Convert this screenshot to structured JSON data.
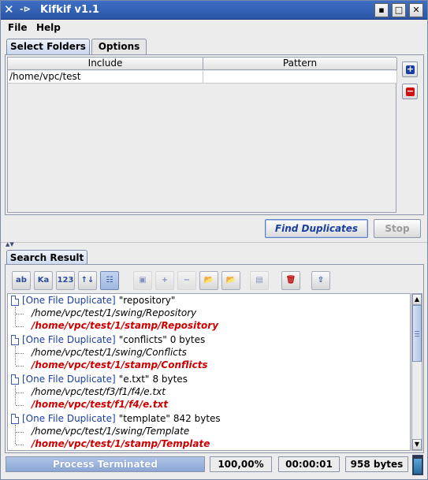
{
  "window": {
    "title": "Kifkif v1.1",
    "buttons": [
      "minimize",
      "maximize",
      "close"
    ],
    "accent_color": "#2a56a6"
  },
  "menu": [
    "File",
    "Help"
  ],
  "tabs": [
    {
      "label": "Select Folders",
      "active": true
    },
    {
      "label": "Options",
      "active": false
    }
  ],
  "folders_table": {
    "columns": [
      "Include",
      "Pattern"
    ],
    "rows": [
      {
        "include": "/home/vpc/test",
        "pattern": ""
      }
    ]
  },
  "side_buttons": [
    {
      "icon": "plus-icon",
      "color": "#1a3fa0"
    },
    {
      "icon": "minus-icon",
      "color": "#cc1111"
    }
  ],
  "actions": {
    "find": "Find Duplicates",
    "stop": "Stop"
  },
  "result_tab": "Search Result",
  "toolbar": [
    {
      "name": "sort-by-name",
      "text": "ab",
      "icon": "sort-alpha-icon",
      "state": "normal"
    },
    {
      "name": "sort-by-kind",
      "text": "Ka",
      "icon": "sort-kind-icon",
      "state": "normal"
    },
    {
      "name": "sort-by-number",
      "text": "123",
      "icon": "sort-number-icon",
      "state": "normal"
    },
    {
      "name": "sort-order",
      "text": "↑↓",
      "icon": "sort-order-icon",
      "state": "normal"
    },
    {
      "name": "tree-view",
      "text": "☷",
      "icon": "tree-view-icon",
      "state": "active"
    },
    {
      "name": "select-all",
      "text": "▣",
      "icon": "select-all-icon",
      "state": "disabled"
    },
    {
      "name": "expand",
      "text": "+",
      "icon": "expand-icon",
      "state": "disabled"
    },
    {
      "name": "collapse",
      "text": "−",
      "icon": "collapse-icon",
      "state": "disabled"
    },
    {
      "name": "open-folder",
      "text": "📂",
      "icon": "open-folder-icon",
      "state": "normal"
    },
    {
      "name": "open-folder-red",
      "text": "📂",
      "icon": "open-folder-red-icon",
      "state": "normal"
    },
    {
      "name": "properties",
      "text": "▤",
      "icon": "properties-icon",
      "state": "disabled"
    },
    {
      "name": "delete",
      "text": "🗑",
      "icon": "trash-icon",
      "state": "normal"
    },
    {
      "name": "export",
      "text": "⇧",
      "icon": "export-icon",
      "state": "normal"
    }
  ],
  "results": [
    {
      "type": "[One File Duplicate]",
      "name": "\"repository\"",
      "size": "",
      "paths": [
        {
          "text": "/home/vpc/test/1/swing/Repository",
          "keep": false
        },
        {
          "text": "/home/vpc/test/1/stamp/Repository",
          "keep": true
        }
      ]
    },
    {
      "type": "[One File Duplicate]",
      "name": "\"conflicts\"",
      "size": "0 bytes",
      "paths": [
        {
          "text": "/home/vpc/test/1/swing/Conflicts",
          "keep": false
        },
        {
          "text": "/home/vpc/test/1/stamp/Conflicts",
          "keep": true
        }
      ]
    },
    {
      "type": "[One File Duplicate]",
      "name": "\"e.txt\"",
      "size": "8 bytes",
      "paths": [
        {
          "text": "/home/vpc/test/f3/f1/f4/e.txt",
          "keep": false
        },
        {
          "text": "/home/vpc/test/f1/f4/e.txt",
          "keep": true
        }
      ]
    },
    {
      "type": "[One File Duplicate]",
      "name": "\"template\"",
      "size": "842 bytes",
      "paths": [
        {
          "text": "/home/vpc/test/1/swing/Template",
          "keep": false
        },
        {
          "text": "/home/vpc/test/1/stamp/Template",
          "keep": true
        }
      ]
    }
  ],
  "status": {
    "process": "Process Terminated",
    "progress_percent": 100,
    "percent_text": "100,00%",
    "elapsed": "00:00:01",
    "size": "958 bytes",
    "memory_fraction": 0.85
  }
}
